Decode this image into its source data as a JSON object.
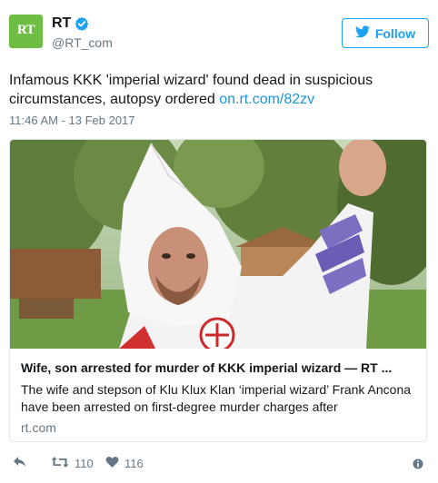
{
  "account": {
    "name": "RT",
    "handle": "@RT_com",
    "avatar_text": "RT",
    "verified": true
  },
  "follow_label": "Follow",
  "tweet": {
    "text": "Infamous KKK 'imperial wizard' found dead in suspicious circumstances, autopsy ordered",
    "link_text": "on.rt.com/82zv",
    "timestamp": "11:46 AM - 13 Feb 2017"
  },
  "card": {
    "title": "Wife, son arrested for murder of KKK imperial wizard — RT ...",
    "description": "The wife and stepson of Klu Klux Klan ‘imperial wizard’ Frank Ancona have been arrested on first-degree murder charges after",
    "domain": "rt.com"
  },
  "actions": {
    "retweet_count": "110",
    "like_count": "116"
  },
  "colors": {
    "accent": "#1da1f2",
    "link": "#1b95e0",
    "avatar_bg": "#6fbe44",
    "muted": "#657786"
  }
}
